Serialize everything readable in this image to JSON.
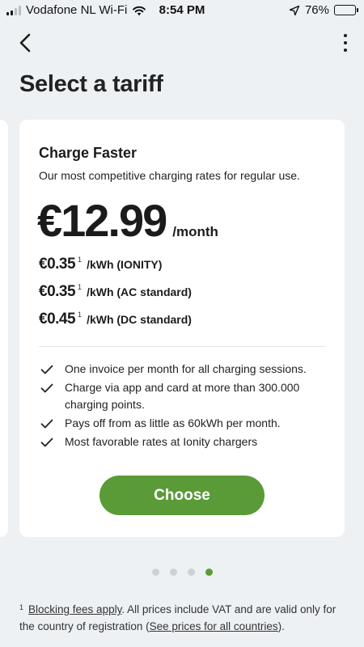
{
  "status_bar": {
    "carrier": "Vodafone NL Wi-Fi",
    "time": "8:54 PM",
    "battery_percent": "76%",
    "battery_level": 0.76
  },
  "nav": {
    "back_icon": "chevron-left-icon",
    "more_icon": "more-vertical-icon"
  },
  "page_title": "Select a tariff",
  "card": {
    "name": "Charge Faster",
    "description": "Our most competitive charging rates for regular use.",
    "price": "€12.99",
    "price_unit": "/month",
    "rates": [
      {
        "price": "€0.35",
        "sup": "1",
        "label": "/kWh (IONITY)"
      },
      {
        "price": "€0.35",
        "sup": "1",
        "label": "/kWh (AC standard)"
      },
      {
        "price": "€0.45",
        "sup": "1",
        "label": "/kWh (DC standard)"
      }
    ],
    "features": [
      "One invoice per month for all charging sessions.",
      "Charge via app and card at more than 300.000 charging points.",
      "Pays off from as little as 60kWh per month.",
      "Most favorable rates at Ionity chargers"
    ],
    "choose_label": "Choose"
  },
  "pagination": {
    "total": 4,
    "active_index": 3
  },
  "footnote": {
    "marker": "1",
    "link1": "Blocking fees apply",
    "text1": ". All prices include VAT and are valid only for the country of registration (",
    "link2": "See prices for all countries",
    "text2": ")."
  },
  "colors": {
    "accent": "#5a9a37",
    "background": "#eef1f4",
    "card": "#ffffff",
    "dot_inactive": "#cdd1d5"
  }
}
